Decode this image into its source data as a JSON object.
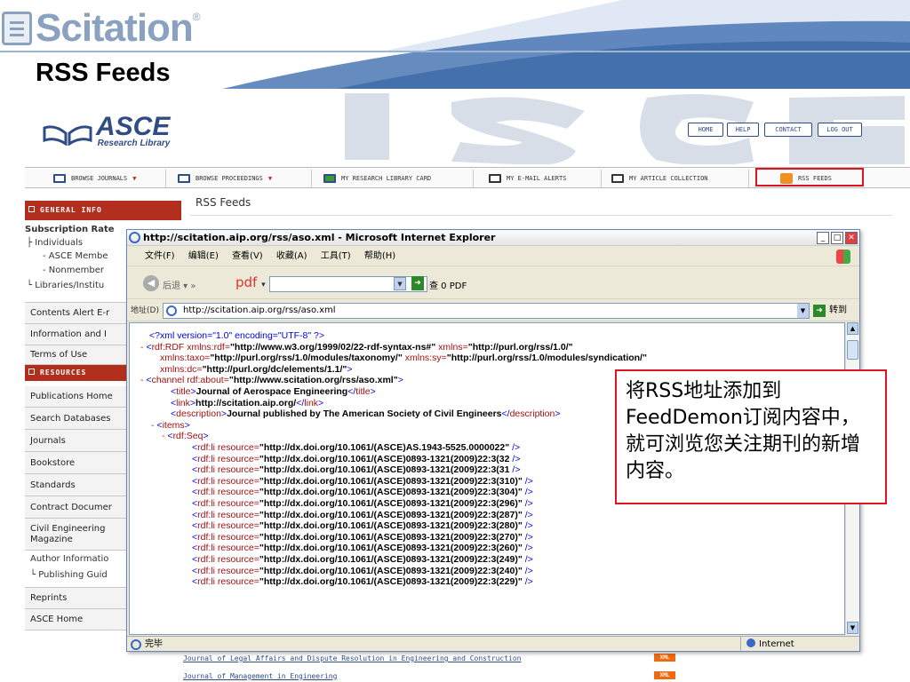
{
  "slide": {
    "brand": "Scitation",
    "brand_mark": "®",
    "title": "RSS Feeds"
  },
  "site": {
    "logo": "ASCE",
    "logo_sub": "Research Library",
    "top_buttons": [
      "HOME",
      "HELP",
      "CONTACT",
      "LOG OUT"
    ],
    "nav": [
      {
        "label": "BROWSE JOURNALS",
        "icon": "journal-icon",
        "has_dropdown": true
      },
      {
        "label": "BROWSE PROCEEDINGS",
        "icon": "proceedings-icon",
        "has_dropdown": true
      },
      {
        "label": "MY RESEARCH LIBRARY CARD",
        "icon": "card-icon",
        "has_dropdown": false
      },
      {
        "label": "MY E-MAIL ALERTS",
        "icon": "email-icon",
        "has_dropdown": false
      },
      {
        "label": "MY ARTICLE COLLECTION",
        "icon": "collection-icon",
        "has_dropdown": false
      },
      {
        "label": "RSS FEEDS",
        "icon": "rss-icon",
        "has_dropdown": false
      }
    ],
    "page_heading": "RSS Feeds",
    "sidebar": {
      "general_header": "GENERAL INFO",
      "subscription_title": "Subscription Rate",
      "subscription_items": [
        "Individuals",
        "- ASCE Membe",
        "- Nonmember",
        "Libraries/Institu"
      ],
      "items_a": [
        "Contents Alert E-r",
        "Information and I",
        "Terms of Use"
      ],
      "resources_header": "RESOURCES",
      "items_b": [
        "Publications Home",
        "Search Databases",
        "Journals",
        "Bookstore",
        "Standards",
        "Contract Documer"
      ],
      "civil_eng": "Civil Engineering Magazine",
      "author_info": "Author Informatio",
      "publishing_guide": "Publishing Guid",
      "reprints": "Reprints",
      "asce_home": "ASCE Home"
    },
    "journal_links": [
      {
        "name": "Journal of Legal Affairs and Dispute Resolution in Engineering and Construction",
        "badge": "XML"
      },
      {
        "name": "Journal of Management in Engineering",
        "badge": "XML"
      }
    ]
  },
  "ie": {
    "title": "http://scitation.aip.org/rss/aso.xml - Microsoft Internet Explorer",
    "menu": [
      "文件(F)",
      "编辑(E)",
      "查看(V)",
      "收藏(A)",
      "工具(T)",
      "帮助(H)"
    ],
    "back_label": "后退",
    "chevron": "»",
    "pdf_label": "pdf",
    "toolbar_misc": "查  0  PDF",
    "address_label": "地址(D)",
    "address": "http://scitation.aip.org/rss/aso.xml",
    "go_label": "转到",
    "status": "完毕",
    "zone": "Internet",
    "xml_lines": [
      {
        "parts": [
          [
            "mk",
            "<?xml version=\"1.0\" encoding=\"UTF-8\" ?>"
          ]
        ]
      },
      {
        "minus": true,
        "parts": [
          [
            "mk",
            "<"
          ],
          [
            "tg",
            "rdf:RDF"
          ],
          [
            "at",
            " xmlns:rdf="
          ],
          [
            "vb",
            "\"http://www.w3.org/1999/02/22-rdf-syntax-ns#\""
          ],
          [
            "at",
            " xmlns="
          ],
          [
            "vb",
            "\"http://purl.org/rss/1.0/\""
          ]
        ]
      },
      {
        "indent": 1,
        "parts": [
          [
            "at",
            "xmlns:taxo="
          ],
          [
            "vb",
            "\"http://purl.org/rss/1.0/modules/taxonomy/\""
          ],
          [
            "at",
            " xmlns:sy="
          ],
          [
            "vb",
            "\"http://purl.org/rss/1.0/modules/syndication/\""
          ]
        ]
      },
      {
        "indent": 1,
        "parts": [
          [
            "at",
            "xmlns:dc="
          ],
          [
            "vb",
            "\"http://purl.org/dc/elements/1.1/\""
          ],
          [
            "mk",
            ">"
          ]
        ]
      },
      {
        "minus": true,
        "indent": 0,
        "parts": [
          [
            "mk",
            "<"
          ],
          [
            "tg",
            "channel"
          ],
          [
            "at",
            " rdf:about="
          ],
          [
            "vb",
            "\"http://www.scitation.org/rss/aso.xml\""
          ],
          [
            "mk",
            ">"
          ]
        ]
      },
      {
        "indent": 2,
        "parts": [
          [
            "mk",
            "<"
          ],
          [
            "tg",
            "title"
          ],
          [
            "mk",
            ">"
          ],
          [
            "vb",
            "Journal of Aerospace Engineering"
          ],
          [
            "mk",
            "</"
          ],
          [
            "tg",
            "title"
          ],
          [
            "mk",
            ">"
          ]
        ]
      },
      {
        "indent": 2,
        "parts": [
          [
            "mk",
            "<"
          ],
          [
            "tg",
            "link"
          ],
          [
            "mk",
            ">"
          ],
          [
            "vb",
            "http://scitation.aip.org/"
          ],
          [
            "mk",
            "</"
          ],
          [
            "tg",
            "link"
          ],
          [
            "mk",
            ">"
          ]
        ]
      },
      {
        "indent": 2,
        "parts": [
          [
            "mk",
            "<"
          ],
          [
            "tg",
            "description"
          ],
          [
            "mk",
            ">"
          ],
          [
            "vb",
            "Journal published by The American Society of Civil Engineers"
          ],
          [
            "mk",
            "</"
          ],
          [
            "tg",
            "description"
          ],
          [
            "mk",
            ">"
          ]
        ]
      },
      {
        "minus": true,
        "indent": 1,
        "parts": [
          [
            "mk",
            "<"
          ],
          [
            "tg",
            "items"
          ],
          [
            "mk",
            ">"
          ]
        ]
      },
      {
        "minus": true,
        "indent": 2,
        "parts": [
          [
            "mk",
            "<"
          ],
          [
            "tg",
            "rdf:Seq"
          ],
          [
            "mk",
            ">"
          ]
        ]
      },
      {
        "indent": 4,
        "parts": [
          [
            "mk",
            "<"
          ],
          [
            "tg",
            "rdf:li"
          ],
          [
            "at",
            " resource="
          ],
          [
            "vb",
            "\"http://dx.doi.org/10.1061/(ASCE)AS.1943-5525.0000022\""
          ],
          [
            "mk",
            " />"
          ]
        ]
      },
      {
        "indent": 4,
        "parts": [
          [
            "mk",
            "<"
          ],
          [
            "tg",
            "rdf:li"
          ],
          [
            "at",
            " resource="
          ],
          [
            "vb",
            "\"http://dx.doi.org/10.1061/(ASCE)0893-1321(2009)22:3(32"
          ],
          [
            "mk",
            " />"
          ]
        ]
      },
      {
        "indent": 4,
        "parts": [
          [
            "mk",
            "<"
          ],
          [
            "tg",
            "rdf:li"
          ],
          [
            "at",
            " resource="
          ],
          [
            "vb",
            "\"http://dx.doi.org/10.1061/(ASCE)0893-1321(2009)22:3(31"
          ],
          [
            "mk",
            " />"
          ]
        ]
      },
      {
        "indent": 4,
        "parts": [
          [
            "mk",
            "<"
          ],
          [
            "tg",
            "rdf:li"
          ],
          [
            "at",
            " resource="
          ],
          [
            "vb",
            "\"http://dx.doi.org/10.1061/(ASCE)0893-1321(2009)22:3(310)\""
          ],
          [
            "mk",
            " />"
          ]
        ]
      },
      {
        "indent": 4,
        "parts": [
          [
            "mk",
            "<"
          ],
          [
            "tg",
            "rdf:li"
          ],
          [
            "at",
            " resource="
          ],
          [
            "vb",
            "\"http://dx.doi.org/10.1061/(ASCE)0893-1321(2009)22:3(304)\""
          ],
          [
            "mk",
            " />"
          ]
        ]
      },
      {
        "indent": 4,
        "parts": [
          [
            "mk",
            "<"
          ],
          [
            "tg",
            "rdf:li"
          ],
          [
            "at",
            " resource="
          ],
          [
            "vb",
            "\"http://dx.doi.org/10.1061/(ASCE)0893-1321(2009)22:3(296)\""
          ],
          [
            "mk",
            " />"
          ]
        ]
      },
      {
        "indent": 4,
        "parts": [
          [
            "mk",
            "<"
          ],
          [
            "tg",
            "rdf:li"
          ],
          [
            "at",
            " resource="
          ],
          [
            "vb",
            "\"http://dx.doi.org/10.1061/(ASCE)0893-1321(2009)22:3(287)\""
          ],
          [
            "mk",
            " />"
          ]
        ]
      },
      {
        "indent": 4,
        "parts": [
          [
            "mk",
            "<"
          ],
          [
            "tg",
            "rdf:li"
          ],
          [
            "at",
            " resource="
          ],
          [
            "vb",
            "\"http://dx.doi.org/10.1061/(ASCE)0893-1321(2009)22:3(280)\""
          ],
          [
            "mk",
            " />"
          ]
        ]
      },
      {
        "indent": 4,
        "parts": [
          [
            "mk",
            "<"
          ],
          [
            "tg",
            "rdf:li"
          ],
          [
            "at",
            " resource="
          ],
          [
            "vb",
            "\"http://dx.doi.org/10.1061/(ASCE)0893-1321(2009)22:3(270)\""
          ],
          [
            "mk",
            " />"
          ]
        ]
      },
      {
        "indent": 4,
        "parts": [
          [
            "mk",
            "<"
          ],
          [
            "tg",
            "rdf:li"
          ],
          [
            "at",
            " resource="
          ],
          [
            "vb",
            "\"http://dx.doi.org/10.1061/(ASCE)0893-1321(2009)22:3(260)\""
          ],
          [
            "mk",
            " />"
          ]
        ]
      },
      {
        "indent": 4,
        "parts": [
          [
            "mk",
            "<"
          ],
          [
            "tg",
            "rdf:li"
          ],
          [
            "at",
            " resource="
          ],
          [
            "vb",
            "\"http://dx.doi.org/10.1061/(ASCE)0893-1321(2009)22:3(249)\""
          ],
          [
            "mk",
            " />"
          ]
        ]
      },
      {
        "indent": 4,
        "parts": [
          [
            "mk",
            "<"
          ],
          [
            "tg",
            "rdf:li"
          ],
          [
            "at",
            " resource="
          ],
          [
            "vb",
            "\"http://dx.doi.org/10.1061/(ASCE)0893-1321(2009)22:3(240)\""
          ],
          [
            "mk",
            " />"
          ]
        ]
      },
      {
        "indent": 4,
        "parts": [
          [
            "mk",
            "<"
          ],
          [
            "tg",
            "rdf:li"
          ],
          [
            "at",
            " resource="
          ],
          [
            "vb",
            "\"http://dx.doi.org/10.1061/(ASCE)0893-1321(2009)22:3(229)\""
          ],
          [
            "mk",
            " />"
          ]
        ]
      }
    ]
  },
  "callout": {
    "text": "将RSS地址添加到FeedDemon订阅内容中，就可浏览您关注期刊的新增内容。"
  },
  "colors": {
    "brand_gray": "#8aa2bf",
    "asce_blue": "#2f4d84",
    "sidebar_red": "#b22f1e",
    "highlight_red": "#e0141e",
    "header_swoosh": "#4a77b4"
  }
}
